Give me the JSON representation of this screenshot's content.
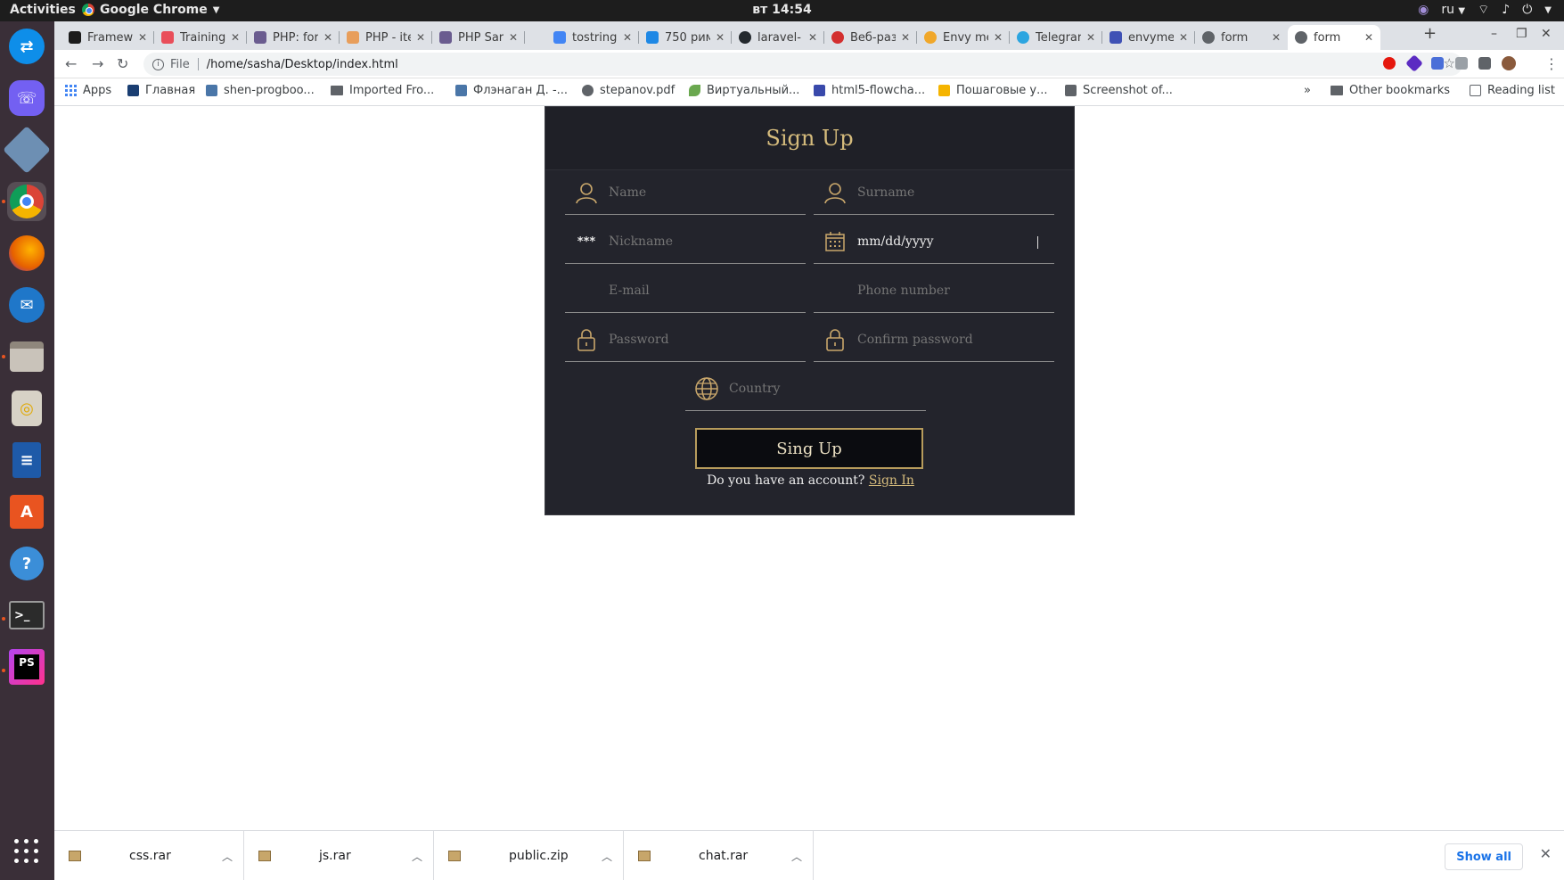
{
  "topbar": {
    "activities": "Activities",
    "app_menu": "Google Chrome",
    "clock": "вт 14:54",
    "lang": "ru"
  },
  "dock": {
    "items": [
      "teamviewer-icon",
      "viber-icon",
      "virtualbox-icon",
      "chrome-icon",
      "firefox-icon",
      "thunderbird-icon",
      "files-icon",
      "rhythmbox-icon",
      "libreoffice-writer-icon",
      "software-center-icon",
      "help-icon",
      "terminal-icon",
      "phpstorm-icon"
    ]
  },
  "tabs": [
    {
      "label": "Framew",
      "fav": "#1c1c1c"
    },
    {
      "label": "Training",
      "fav": "#e94e5a"
    },
    {
      "label": "PHP: for",
      "fav": "#6a5c8f"
    },
    {
      "label": "PHP - ite",
      "fav": "#e89e5b"
    },
    {
      "label": "PHP Sar",
      "fav": "#6a5c8f"
    },
    {
      "label": "tostring",
      "fav": "#4285f4"
    },
    {
      "label": "750 рим",
      "fav": "#1e88e5"
    },
    {
      "label": "laravel-",
      "fav": "#24292e"
    },
    {
      "label": "Веб-раз",
      "fav": "#d32f2f"
    },
    {
      "label": "Envy me",
      "fav": "#f0a72a"
    },
    {
      "label": "Telegrar",
      "fav": "#2ca5e0"
    },
    {
      "label": "envyme",
      "fav": "#3f51b5"
    },
    {
      "label": "form",
      "fav": "#5f6368"
    },
    {
      "label": "form",
      "fav": "#5f6368"
    }
  ],
  "browser": {
    "scheme": "File",
    "url": "/home/sasha/Desktop/index.html"
  },
  "bookmarks": [
    {
      "label": "Apps",
      "fav": "#4285f4"
    },
    {
      "label": "Главная",
      "fav": "#1a3e72"
    },
    {
      "label": "shen-progboo...",
      "fav": "#4a76a8"
    },
    {
      "label": "Imported Fro...",
      "fav": "#5f6368"
    },
    {
      "label": "Флэнаган Д. -...",
      "fav": "#4a76a8"
    },
    {
      "label": "stepanov.pdf",
      "fav": "#5f6368"
    },
    {
      "label": "Виртуальный...",
      "fav": "#6aa84f"
    },
    {
      "label": "html5-flowcha...",
      "fav": "#3949ab"
    },
    {
      "label": "Пошаговые у...",
      "fav": "#f5b400"
    },
    {
      "label": "Screenshot of...",
      "fav": "#5f6368"
    }
  ],
  "bookmarks_right": {
    "more": "»",
    "other": "Other bookmarks",
    "reading": "Reading list"
  },
  "form": {
    "title": "Sign Up",
    "fields": {
      "name": "Name",
      "surname": "Surname",
      "nickname": "Nickname",
      "birthdate": "mm/dd/yyyy",
      "email": "E-mail",
      "phone": "Phone number",
      "password": "Password",
      "confirm": "Confirm password",
      "country": "Country"
    },
    "nickname_icon": "***",
    "submit": "Sing Up",
    "account_prompt": "Do you have an account?",
    "signin_link": "Sign In"
  },
  "downloads": {
    "files": [
      "css.rar",
      "js.rar",
      "public.zip",
      "chat.rar"
    ],
    "show_all": "Show all"
  }
}
